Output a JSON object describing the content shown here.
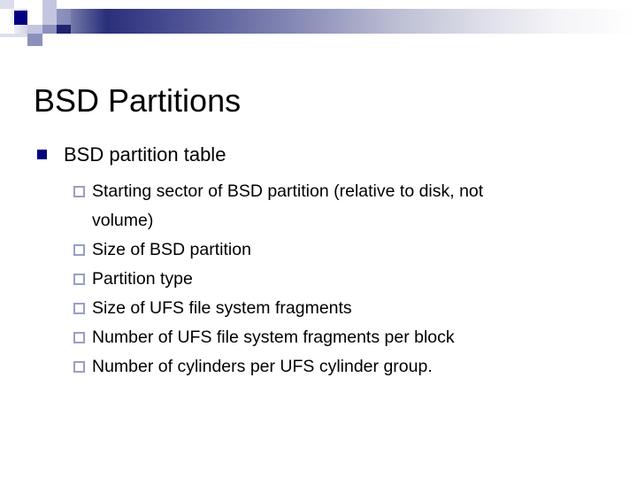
{
  "slide": {
    "title": "BSD Partitions",
    "level1": {
      "text": "BSD partition table",
      "bullet_glyph": "filled-square"
    },
    "level2_bullet_glyph": "hollow-square",
    "bullets": [
      {
        "line1": "Starting sector of BSD partition (relative to disk, not",
        "line2": "volume)"
      },
      {
        "line1": "Size of BSD partition",
        "line2": ""
      },
      {
        "line1": "Partition type",
        "line2": ""
      },
      {
        "line1": "Size of UFS file system fragments",
        "line2": ""
      },
      {
        "line1": "Number of UFS file system fragments per block",
        "line2": ""
      },
      {
        "line1": "Number of cylinders per UFS cylinder group.",
        "line2": ""
      }
    ]
  },
  "decoration": {
    "band_color_dark": "#2a2f7a",
    "band_color_light": "#ffffff",
    "square_navy": "#000080",
    "square_mid": "#8c90bd",
    "square_light": "#c3c6de"
  }
}
